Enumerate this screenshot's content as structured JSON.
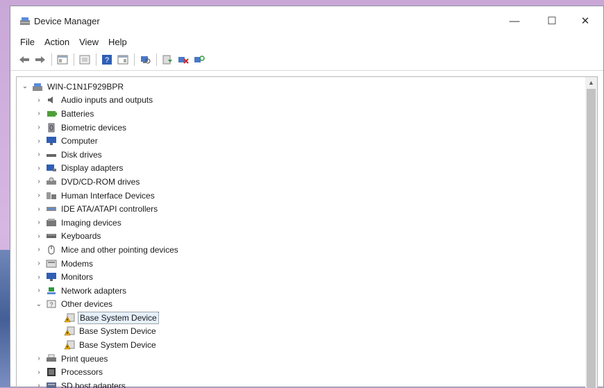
{
  "window": {
    "title": "Device Manager",
    "controls": {
      "minimize": "—",
      "maximize": "☐",
      "close": "✕"
    }
  },
  "menu": [
    "File",
    "Action",
    "View",
    "Help"
  ],
  "toolbar_icons": [
    "back-arrow-icon",
    "forward-arrow-icon",
    "show-hide-console-tree-icon",
    "properties-icon",
    "help-icon",
    "view-icon",
    "scan-hardware-icon",
    "update-driver-icon",
    "uninstall-device-icon",
    "enable-device-icon"
  ],
  "tree": {
    "root": {
      "label": "WIN-C1N1F929BPR",
      "expander": "⌄",
      "icon": "computer-icon"
    },
    "categories": [
      {
        "label": "Audio inputs and outputs",
        "expander": "›",
        "icon": "speaker-icon"
      },
      {
        "label": "Batteries",
        "expander": "›",
        "icon": "battery-icon"
      },
      {
        "label": "Biometric devices",
        "expander": "›",
        "icon": "biometric-icon"
      },
      {
        "label": "Computer",
        "expander": "›",
        "icon": "monitor-icon"
      },
      {
        "label": "Disk drives",
        "expander": "›",
        "icon": "disk-drive-icon"
      },
      {
        "label": "Display adapters",
        "expander": "›",
        "icon": "display-adapter-icon"
      },
      {
        "label": "DVD/CD-ROM drives",
        "expander": "›",
        "icon": "dvd-drive-icon"
      },
      {
        "label": "Human Interface Devices",
        "expander": "›",
        "icon": "hid-icon"
      },
      {
        "label": "IDE ATA/ATAPI controllers",
        "expander": "›",
        "icon": "ide-controller-icon"
      },
      {
        "label": "Imaging devices",
        "expander": "›",
        "icon": "imaging-device-icon"
      },
      {
        "label": "Keyboards",
        "expander": "›",
        "icon": "keyboard-icon"
      },
      {
        "label": "Mice and other pointing devices",
        "expander": "›",
        "icon": "mouse-icon"
      },
      {
        "label": "Modems",
        "expander": "›",
        "icon": "modem-icon"
      },
      {
        "label": "Monitors",
        "expander": "›",
        "icon": "monitor-icon"
      },
      {
        "label": "Network adapters",
        "expander": "›",
        "icon": "network-adapter-icon"
      },
      {
        "label": "Other devices",
        "expander": "⌄",
        "icon": "unknown-device-icon"
      }
    ],
    "other_devices": [
      {
        "label": "Base System Device",
        "icon": "warning-device-icon",
        "selected": true
      },
      {
        "label": "Base System Device",
        "icon": "warning-device-icon",
        "selected": false
      },
      {
        "label": "Base System Device",
        "icon": "warning-device-icon",
        "selected": false
      }
    ],
    "after": [
      {
        "label": "Print queues",
        "expander": "›",
        "icon": "printer-icon"
      },
      {
        "label": "Processors",
        "expander": "›",
        "icon": "processor-icon"
      },
      {
        "label": "SD host adapters",
        "expander": "›",
        "icon": "sd-adapter-icon"
      }
    ]
  },
  "scrollbar": {
    "up_arrow": "▲"
  },
  "colors": {
    "selection": "#e5f0fb",
    "warning": "#e8b100",
    "desktop": "#c9a8d8"
  }
}
